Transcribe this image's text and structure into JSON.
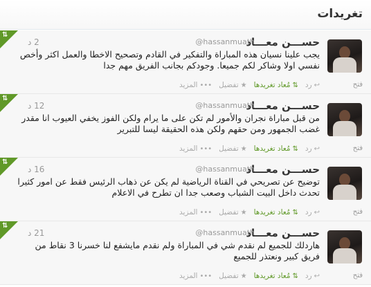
{
  "widget": {
    "title": "تغريدات"
  },
  "tweets": [
    {
      "name": "حســـن معـــاد",
      "handle": "@hassanmuath",
      "time": "2 د",
      "text": "يجب علينا نسيان هذه المباراة والتفكير في القادم وتصحيح الاخطا والعمل اكثر وأخص نفسي اولا وشاكر لكم جميعا.  وجودكم بجانب الفريق مهم جدا",
      "open": "فتح",
      "reply": "رد",
      "retweeted": "مُعاد تغريدها",
      "favorite": "تفضيل",
      "more": "المزيد"
    },
    {
      "name": "حســـن معـــاد",
      "handle": "@hassanmuath",
      "time": "12 د",
      "text": "من قبل مباراة نجران والأمور لم تكن على ما يرام ولكن الفوز يخفي العيوب انا مقدر غضب الجمهور ومن حقهم ولكن هذه الحقيقة ليسا للتبرير",
      "open": "فتح",
      "reply": "رد",
      "retweeted": "مُعاد تغريدها",
      "favorite": "تفضيل",
      "more": "المزيد"
    },
    {
      "name": "حســـن معـــاد",
      "handle": "@hassanmuath",
      "time": "16 د",
      "text": "توضيح  عن تصريحي في القناة الرياضية لم يكن عن ذهاب الرئيس فقط عن امور كثيرا تحدث داخل البيت الشباب وصعب جدا ان تطرح في الاعلام",
      "open": "فتح",
      "reply": "رد",
      "retweeted": "مُعاد تغريدها",
      "favorite": "تفضيل",
      "more": "المزيد"
    },
    {
      "name": "حســـن معـــاد",
      "handle": "@hassanmuath",
      "time": "21 د",
      "text": "هاردلك للجميع لم نقدم شي في المباراة ولم نقدم مايشفع لنا خسرنا 3 نقاط من فريق كبير ونعتذر للجميع",
      "open": "فتح",
      "reply": "رد",
      "retweeted": "مُعاد تغريدها",
      "favorite": "تفضيل",
      "more": "المزيد"
    }
  ],
  "colors": {
    "retweet_green": "#609928",
    "muted": "#999999",
    "header_bg": "#f7f7f7"
  },
  "icons": {
    "retweet": "retweet-icon",
    "reply": "reply-icon",
    "favorite": "star-icon",
    "more": "more-dots-icon"
  }
}
